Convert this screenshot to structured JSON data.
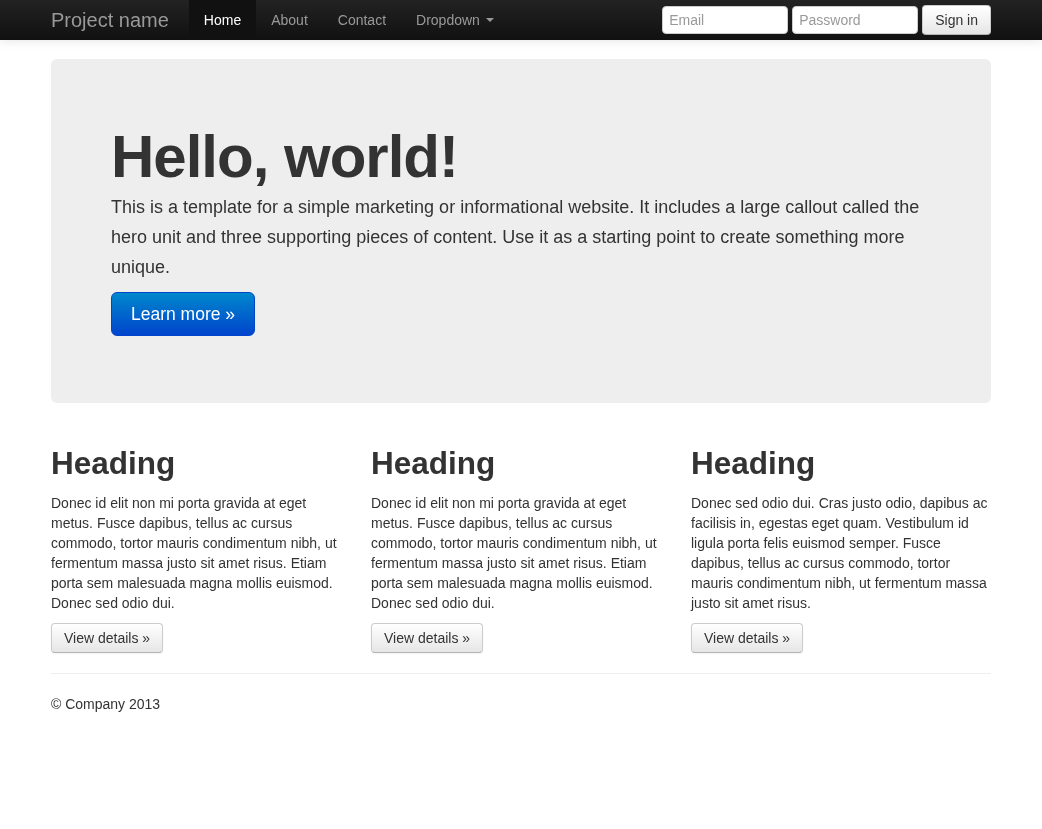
{
  "navbar": {
    "brand": "Project name",
    "items": [
      {
        "label": "Home",
        "selected": true,
        "kind": "link"
      },
      {
        "label": "About",
        "selected": false,
        "kind": "link"
      },
      {
        "label": "Contact",
        "selected": false,
        "kind": "link"
      },
      {
        "label": "Dropdown",
        "selected": false,
        "kind": "dropdown"
      }
    ],
    "email": {
      "placeholder": "Email"
    },
    "password": {
      "placeholder": "Password"
    },
    "sign_in": "Sign in"
  },
  "hero": {
    "title": "Hello, world!",
    "text": "This is a template for a simple marketing or informational website. It includes a large callout called the hero unit and three supporting pieces of content. Use it as a starting point to create something more unique.",
    "button": "Learn more »"
  },
  "columns": [
    {
      "heading": "Heading",
      "text": "Donec id elit non mi porta gravida at eget metus. Fusce dapibus, tellus ac cursus commodo, tortor mauris condimentum nibh, ut fermentum massa justo sit amet risus. Etiam porta sem malesuada magna mollis euismod. Donec sed odio dui.",
      "button": "View details »"
    },
    {
      "heading": "Heading",
      "text": "Donec id elit non mi porta gravida at eget metus. Fusce dapibus, tellus ac cursus commodo, tortor mauris condimentum nibh, ut fermentum massa justo sit amet risus. Etiam porta sem malesuada magna mollis euismod. Donec sed odio dui.",
      "button": "View details »"
    },
    {
      "heading": "Heading",
      "text": "Donec sed odio dui. Cras justo odio, dapibus ac facilisis in, egestas eget quam. Vestibulum id ligula porta felis euismod semper. Fusce dapibus, tellus ac cursus commodo, tortor mauris condimentum nibh, ut fermentum massa justo sit amet risus.",
      "button": "View details »"
    }
  ],
  "footer": "© Company 2013"
}
